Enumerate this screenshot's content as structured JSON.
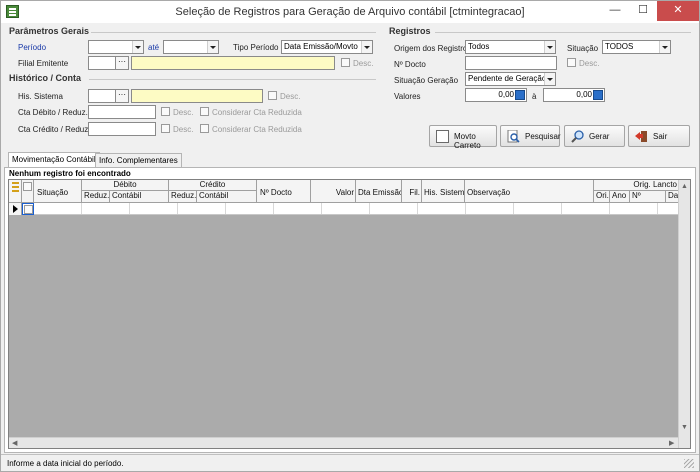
{
  "window": {
    "title": "Seleção de Registros para Geração de Arquivo contábil [ctmintegracao]",
    "minimize": "—",
    "maximize": "☐",
    "close": "✕"
  },
  "general": {
    "heading": "Parâmetros Gerais",
    "periodo_label": "Período",
    "ate_label": "até",
    "periodo_de": "",
    "periodo_ate": "",
    "tipo_periodo_label": "Tipo Período",
    "tipo_periodo_value": "Data Emissão/Movto",
    "filial_label": "Filial Emitente",
    "filial_code": "",
    "filial_name": "",
    "desc_label": "Desc."
  },
  "historico": {
    "heading": "Histórico / Conta",
    "his_label": "His. Sistema",
    "his_code": "",
    "his_name": "",
    "desc_label": "Desc.",
    "debito_label": "Cta Débito / Reduz.",
    "debito_value": "",
    "credito_label": "Cta Crédito / Reduz.",
    "credito_value": "",
    "considerar_label": "Considerar Cta Reduzida"
  },
  "registros": {
    "heading": "Registros",
    "origem_label": "Origem dos Registros",
    "origem_value": "Todos",
    "situacao_label": "Situação",
    "situacao_value": "TODOS",
    "docto_label": "Nº Docto",
    "docto_value": "",
    "desc_label": "Desc.",
    "situacao_geracao_label": "Situação Geração",
    "situacao_geracao_value": "Pendente de Geração",
    "valores_label": "Valores",
    "valor_de": "0,00",
    "a_label": "à",
    "valor_ate": "0,00"
  },
  "buttons": {
    "movto": "Movto Carreto",
    "pesquisar": "Pesquisar",
    "gerar": "Gerar",
    "sair": "Sair"
  },
  "tabs": [
    "Movimentação Contábil",
    "Info. Complementares"
  ],
  "grid": {
    "empty_message": "Nenhum registro foi encontrado",
    "situacao": "Situação",
    "debito": "Débito",
    "credito": "Crédito",
    "reduz": "Reduz.",
    "contabil": "Contábil",
    "docto": "Nº Docto",
    "valor": "Valor",
    "emissao": "Dta Emissão",
    "fil": "Fil.",
    "his": "His. Sistema",
    "obs": "Observação",
    "orig": "Orig. Lancto",
    "ori": "Ori.",
    "ano": "Ano",
    "n": "Nº",
    "da": "Da"
  },
  "status": {
    "message": "Informe a data inicial do período."
  }
}
